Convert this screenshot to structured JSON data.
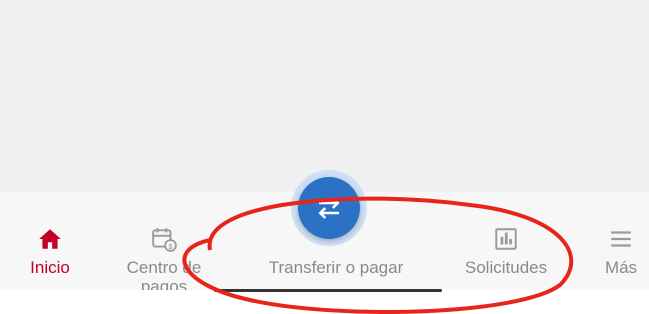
{
  "nav": {
    "items": [
      {
        "label": "Inicio",
        "icon": "home-icon",
        "active": true
      },
      {
        "label": "Centro de pagos",
        "label_line1": "Centro de",
        "label_line2": "pagos",
        "icon": "calendar-payment-icon"
      },
      {
        "label": "Transferir o pagar",
        "icon": "transfer-arrows-icon"
      },
      {
        "label": "Solicitudes",
        "icon": "requests-icon"
      },
      {
        "label": "Más",
        "icon": "menu-icon"
      }
    ],
    "active_color": "#c4002a",
    "inactive_color": "#8a8a8a"
  },
  "fab": {
    "icon": "transfer-arrows-icon",
    "color": "#2b72c6"
  },
  "annotation": {
    "shape": "ellipse",
    "color": "#e8251c"
  }
}
